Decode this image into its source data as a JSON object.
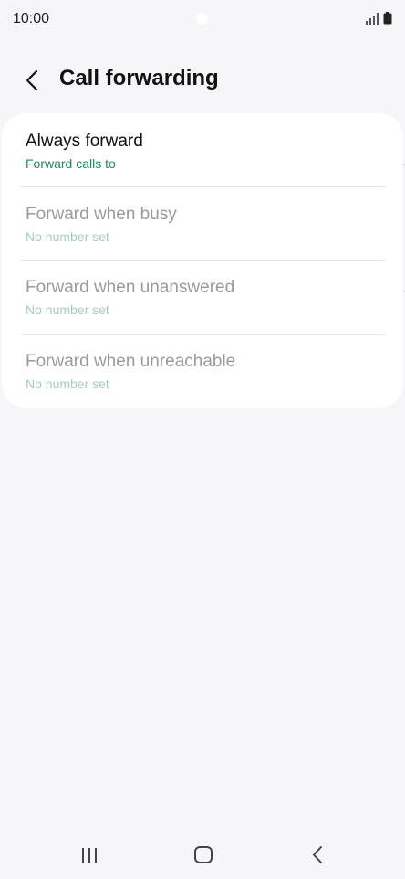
{
  "status_bar": {
    "time": "10:00",
    "icons": [
      "signal-icon",
      "battery-icon"
    ]
  },
  "header": {
    "title": "Call forwarding",
    "back_icon": "chevron-left-icon"
  },
  "forwarding_options": [
    {
      "title": "Always forward",
      "subtitle": "Forward calls to",
      "enabled": true
    },
    {
      "title": "Forward when busy",
      "subtitle": "No number set",
      "enabled": false
    },
    {
      "title": "Forward when unanswered",
      "subtitle": "No number set",
      "enabled": false
    },
    {
      "title": "Forward when unreachable",
      "subtitle": "No number set",
      "enabled": false
    }
  ],
  "navigation_bar": {
    "buttons": [
      "recent-apps-icon",
      "home-icon",
      "back-icon"
    ]
  },
  "colors": {
    "background": "#f6f6f8",
    "card": "#ffffff",
    "accent_green": "#1f8a57",
    "disabled_text": "#9a9a9c",
    "disabled_accent": "#a6cdb8"
  }
}
